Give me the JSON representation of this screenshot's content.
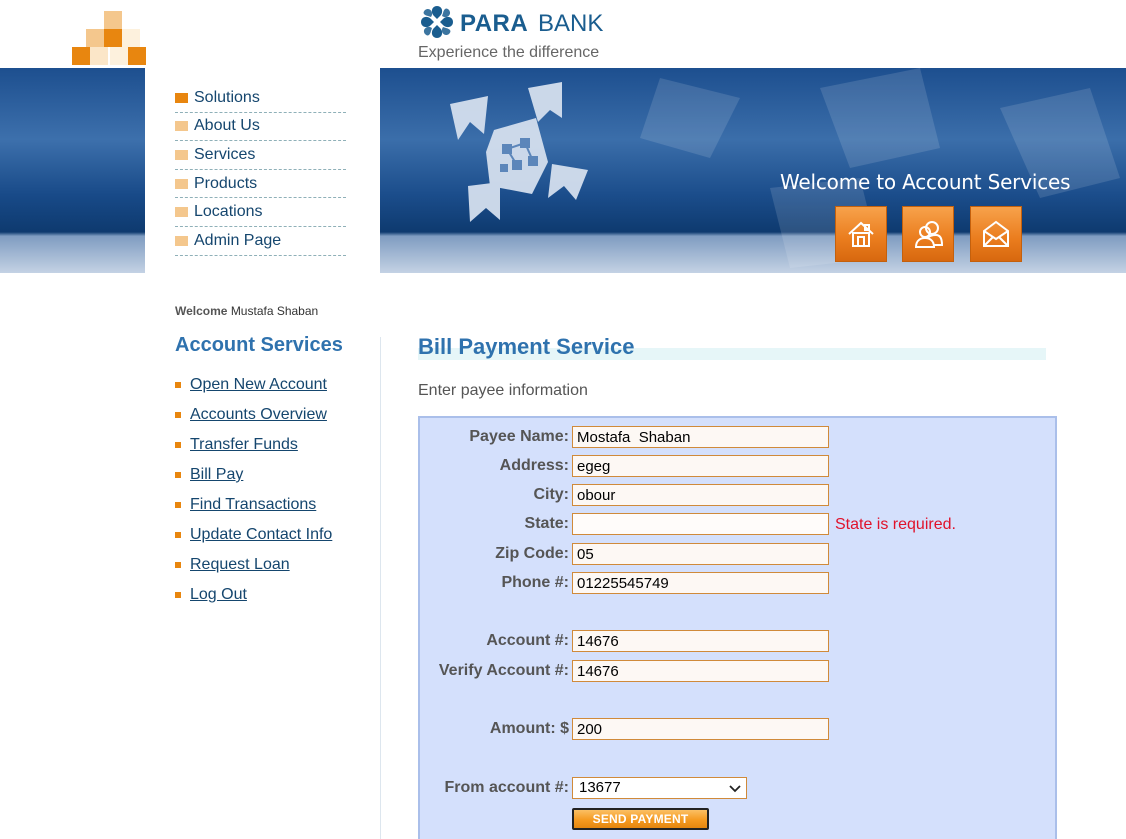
{
  "header": {
    "brand_para": "PARA",
    "brand_bank": "BANK",
    "tagline": "Experience the difference"
  },
  "banner": {
    "welcome": "Welcome to Account Services",
    "icons": [
      "home-icon",
      "about-icon",
      "contact-icon"
    ]
  },
  "top_nav": {
    "items": [
      {
        "label": "Solutions"
      },
      {
        "label": "About Us"
      },
      {
        "label": "Services"
      },
      {
        "label": "Products"
      },
      {
        "label": "Locations"
      },
      {
        "label": "Admin Page"
      }
    ]
  },
  "sidebar": {
    "welcome_label": "Welcome",
    "user_name": "Mustafa Shaban",
    "title": "Account Services",
    "items": [
      {
        "label": "Open New Account"
      },
      {
        "label": "Accounts Overview"
      },
      {
        "label": "Transfer Funds"
      },
      {
        "label": "Bill Pay"
      },
      {
        "label": "Find Transactions"
      },
      {
        "label": "Update Contact Info"
      },
      {
        "label": "Request Loan"
      },
      {
        "label": "Log Out"
      }
    ]
  },
  "main": {
    "title": "Bill Payment Service",
    "subtitle": "Enter payee information",
    "form": {
      "payee_name_label": "Payee Name:",
      "payee_name": "Mostafa  Shaban",
      "address_label": "Address:",
      "address": "egeg",
      "city_label": "City:",
      "city": "obour",
      "state_label": "State:",
      "state": "",
      "state_error": "State is required.",
      "zip_label": "Zip Code:",
      "zip": "05",
      "phone_label": "Phone #:",
      "phone": "01225545749",
      "account_label": "Account #:",
      "account": "14676",
      "verify_account_label": "Verify Account #:",
      "verify_account": "14676",
      "amount_label": "Amount: $",
      "amount": "200",
      "from_account_label": "From account #:",
      "from_account": "13677",
      "submit_label": "SEND PAYMENT"
    }
  },
  "colors": {
    "brand_blue": "#1a5d8f",
    "link_blue": "#15466e",
    "heading_blue": "#2f72ae",
    "accent_orange": "#e8860f",
    "error_red": "#e0122b",
    "form_bg": "#d4e0fc"
  }
}
